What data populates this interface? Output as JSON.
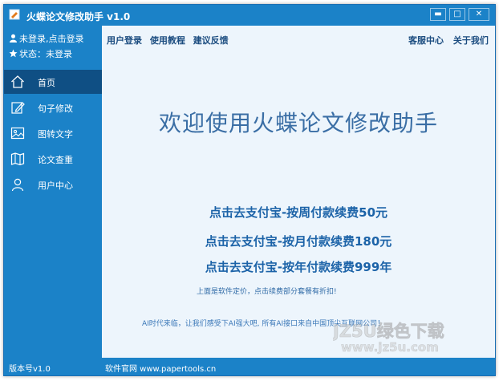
{
  "window": {
    "title": "火蝶论文修改助手 v1.0",
    "controls": {
      "minimize": "▬",
      "maximize": "□",
      "close": "✕"
    }
  },
  "sidebar": {
    "login_prompt": "未登录,点击登录",
    "status_text": "状态：未登录",
    "items": [
      {
        "label": "首页",
        "icon": "home-icon",
        "active": true
      },
      {
        "label": "句子修改",
        "icon": "edit-icon",
        "active": false
      },
      {
        "label": "图转文字",
        "icon": "image-icon",
        "active": false
      },
      {
        "label": "论文查重",
        "icon": "map-icon",
        "active": false
      },
      {
        "label": "用户中心",
        "icon": "user-icon",
        "active": false
      }
    ]
  },
  "topnav": {
    "left": [
      "用户登录",
      "使用教程",
      "建议反馈"
    ],
    "right": [
      "客服中心",
      "关于我们"
    ]
  },
  "main": {
    "welcome": "欢迎使用火蝶论文修改助手",
    "pay_links": [
      "点击去支付宝-按周付款续费50元",
      "点击去支付宝-按月付款续费180元",
      "点击去支付宝-按年付款续费999年"
    ],
    "pricing_note": "上面是软件定价，点击续费部分套餐有折扣!",
    "ai_note": "AI时代来临，让我们感受下AI强大吧, 所有AI接口来自中国顶尖互联网公司！"
  },
  "statusbar": {
    "version": "版本号v1.0",
    "website": "软件官网 www.papertools.cn"
  },
  "watermark": {
    "line1": "JZ5U绿色下载",
    "line2": "www.jz5u.com"
  },
  "colors": {
    "chrome": "#1b82c8",
    "active_nav": "#0f4f84",
    "content_bg": "#edf5fc",
    "link": "#1c63a8"
  }
}
